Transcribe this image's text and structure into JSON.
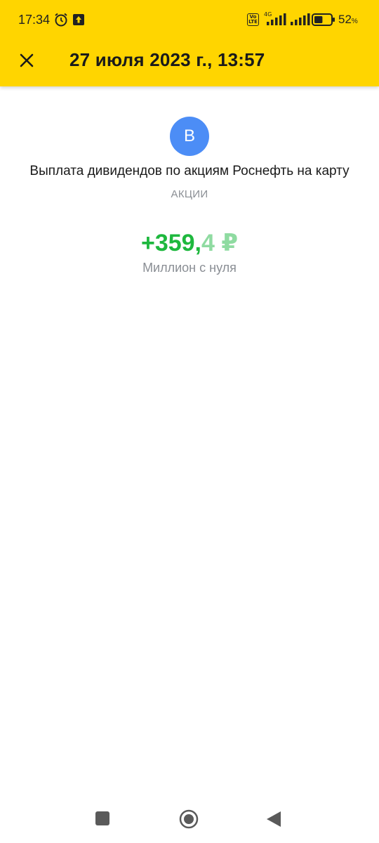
{
  "status_bar": {
    "time": "17:34",
    "volte_label": "Vo LTE",
    "network_type": "4G",
    "battery_percent": "52",
    "battery_unit": "%",
    "battery_level": 0.52,
    "icons": [
      "alarm-icon",
      "upload-icon",
      "volte-icon",
      "signal-icon",
      "signal-icon",
      "battery-icon"
    ]
  },
  "header": {
    "title": "27 июля 2023 г., 13:57",
    "close_icon": "close-icon",
    "background": "#ffd500"
  },
  "transaction": {
    "avatar_letter": "В",
    "avatar_color": "#4c8df6",
    "title": "Выплата дивидендов по акциям Роснефть на карту",
    "category": "АКЦИИ",
    "amount_main": "+359,",
    "amount_fraction": "4 ₽",
    "amount_color": "#1eb83e",
    "account": "Миллион с нуля"
  },
  "nav_bar": {
    "icons": [
      "recents-icon",
      "home-icon",
      "back-icon"
    ]
  }
}
